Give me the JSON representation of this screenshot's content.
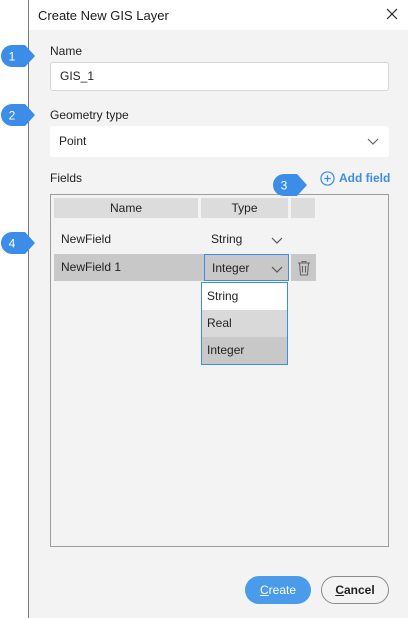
{
  "dialog": {
    "title": "Create New GIS Layer"
  },
  "name_section": {
    "label": "Name",
    "value": "GIS_1"
  },
  "geometry_section": {
    "label": "Geometry type",
    "value": "Point"
  },
  "fields_section": {
    "label": "Fields",
    "add_label": "Add field",
    "columns": [
      "Name",
      "Type"
    ],
    "rows": [
      {
        "name": "NewField",
        "type": "String"
      },
      {
        "name": "NewField 1",
        "type": "Integer"
      }
    ],
    "type_options": [
      "String",
      "Real",
      "Integer"
    ]
  },
  "callouts": [
    "1",
    "2",
    "3",
    "4"
  ],
  "buttons": {
    "create_first": "C",
    "create_rest": "reate",
    "cancel_first": "C",
    "cancel_rest": "ancel"
  },
  "colors": {
    "accent": "#4a9be9",
    "callout": "#3b8de8"
  }
}
